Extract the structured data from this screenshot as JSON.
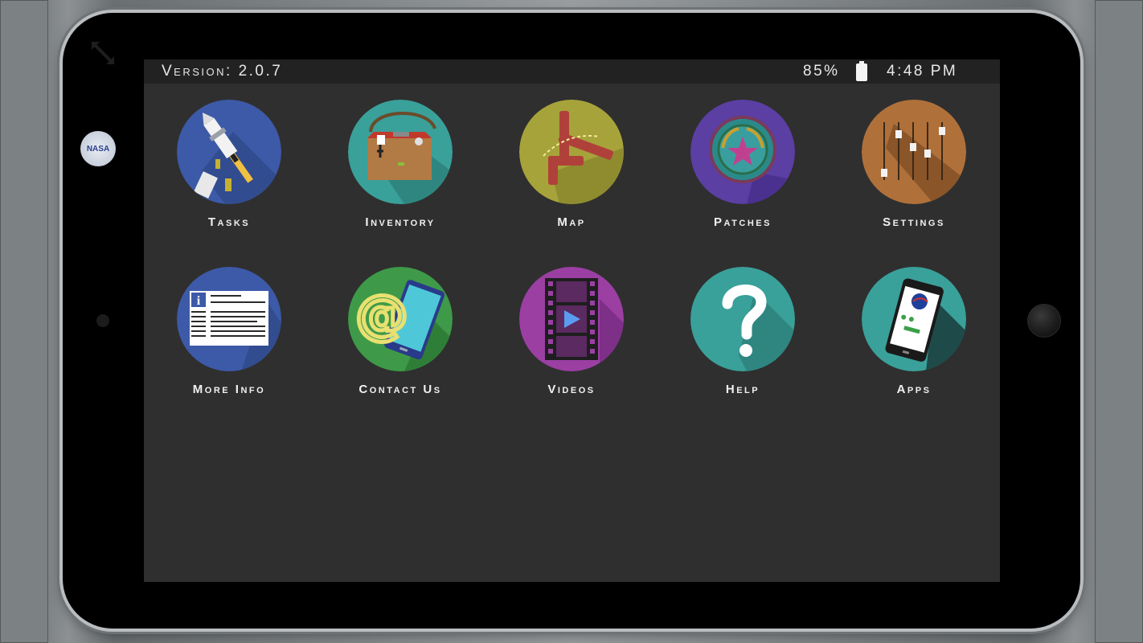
{
  "status_bar": {
    "version": "Version: 2.0.7",
    "battery_percent": "85%",
    "time": "4:48 PM"
  },
  "sticker": {
    "text": "NASA"
  },
  "apps": [
    {
      "label": "Tasks",
      "icon": "rocket-icon",
      "color": "#3d5aa8"
    },
    {
      "label": "Inventory",
      "icon": "toolbag-icon",
      "color": "#3aa09a"
    },
    {
      "label": "Map",
      "icon": "station-map-icon",
      "color": "#a6a33a"
    },
    {
      "label": "Patches",
      "icon": "patch-icon",
      "color": "#5b3fa3"
    },
    {
      "label": "Settings",
      "icon": "sliders-icon",
      "color": "#b0703a"
    },
    {
      "label": "More Info",
      "icon": "info-card-icon",
      "color": "#3d5aa8"
    },
    {
      "label": "Contact Us",
      "icon": "email-tablet-icon",
      "color": "#3e9a48"
    },
    {
      "label": "Videos",
      "icon": "film-play-icon",
      "color": "#9b3fa3"
    },
    {
      "label": "Help",
      "icon": "question-icon",
      "color": "#3aa09a"
    },
    {
      "label": "Apps",
      "icon": "phone-apps-icon",
      "color": "#3aa09a"
    }
  ]
}
